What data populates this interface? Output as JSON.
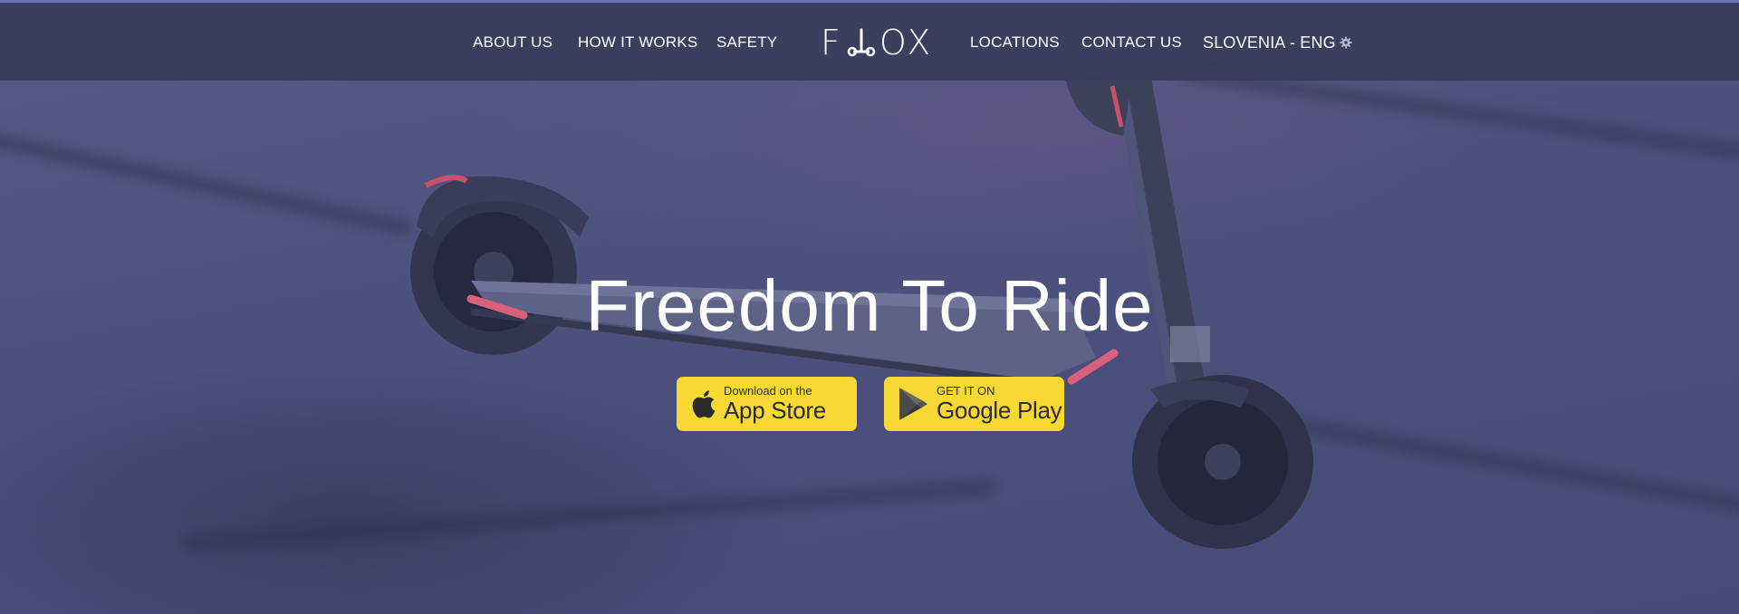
{
  "nav": {
    "items": [
      {
        "label": "ABOUT US"
      },
      {
        "label": "HOW IT WORKS"
      },
      {
        "label": "SAFETY"
      },
      {
        "label": "LOCATIONS"
      },
      {
        "label": "CONTACT US"
      }
    ],
    "language": "SLOVENIA - ENG",
    "language_icon": "gear-icon"
  },
  "logo": {
    "left": "F",
    "right": "OX",
    "mark_icon": "scooter-icon"
  },
  "hero": {
    "headline": "Freedom To Ride",
    "app_store": {
      "small": "Download on the",
      "big": "App Store",
      "icon": "apple-icon"
    },
    "google_play": {
      "small": "GET IT ON",
      "big": "Google Play",
      "icon": "play-store-icon"
    }
  },
  "colors": {
    "navbar": "#3a3e5c",
    "hero_overlay": "#4b507c",
    "button": "#f8d833",
    "accent_line": "#6b73b8"
  }
}
